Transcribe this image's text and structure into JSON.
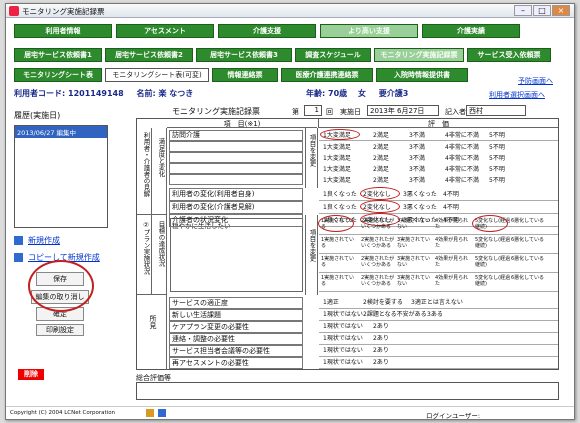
{
  "window": {
    "title": "モニタリング実施記録票"
  },
  "nav_row1": [
    "利用者情報",
    "アセスメント",
    "介護支援",
    "より高い支援",
    "介護実績"
  ],
  "nav_row2": [
    "居宅サービス依頼書1",
    "居宅サービス依頼書2",
    "居宅サービス依頼書3",
    "調査スケジュール",
    "モニタリング実施記録票",
    "サービス受入依頼票"
  ],
  "nav_row3": [
    "モニタリングシート表",
    "モニタリングシート表(可変)",
    "情報連絡票",
    "医療介護連携連絡票",
    "入院時情報提供書"
  ],
  "links": {
    "prev": "予防画面へ",
    "select": "利用者選択画面へ"
  },
  "user": {
    "code_label": "利用者コード:",
    "code": "1201149148",
    "name_label": "名前:",
    "name": "楽 なつき",
    "age_label": "年齢:",
    "age": "70歳",
    "sex": "女",
    "care_label": "要介護3"
  },
  "history": {
    "title": "履歴(実施日)",
    "item": "2013/06/27 編集中"
  },
  "left_links": {
    "new": "新規作成",
    "copy": "コピーして新規作成"
  },
  "buttons": {
    "save": "保存",
    "cancel": "編集の取り消し",
    "confirm": "確定",
    "print": "印刷設定",
    "delete": "削除"
  },
  "form": {
    "title": "モニタリング実施記録票",
    "no_label": "第",
    "no": "1",
    "no_suffix": "回",
    "date_label": "実施日",
    "date": "2013年 6月27日",
    "recorder_label": "記入者",
    "recorder": "西村",
    "col_item": "項　目(※1)",
    "col_eval": "評　価"
  },
  "section1": {
    "label": "利用者・介護者の見解",
    "sub": "満足度と変化",
    "vert": "項目を変更"
  },
  "sat_row": {
    "item": "訪問介護",
    "opts": [
      "1大変満足",
      "2満足",
      "3不満",
      "4非常に不満",
      "5不明"
    ]
  },
  "sat_empty_opts": [
    "1大変満足",
    "2満足",
    "3不満",
    "4非常に不満",
    "5不明"
  ],
  "change_rows": [
    {
      "item": "利用者の変化(利用者自身)",
      "opts": [
        "1良くなった",
        "2変化なし",
        "3悪くなった",
        "4不明"
      ]
    },
    {
      "item": "利用者の変化(介護者見解)",
      "opts": [
        "1良くなった",
        "2変化なし",
        "3悪くなった",
        "4不明"
      ]
    },
    {
      "item": "介護者の状況変化",
      "opts": [
        "1良くなった",
        "2変化なし",
        "3悪くなった",
        "4不明"
      ]
    }
  ],
  "section2": {
    "label": "②プラン実施状況",
    "sub": "目標の達成状況",
    "vert": "項目を変更",
    "item": "穏やかに生活したい"
  },
  "goal_opts": [
    "1実施されている",
    "2実施されたがいくつかある",
    "3実施されていない",
    "4効果が見られた",
    "5変化なし(経過継続)",
    "6悪化している"
  ],
  "section3": {
    "label": "所見"
  },
  "find_rows": [
    {
      "item": "サービスの適正度",
      "opts": [
        "1適正",
        "2検討を要する",
        "3適正とは言えない"
      ]
    },
    {
      "item": "新しい生活課題",
      "opts": [
        "1現状ではない",
        "2課題となる不安がある",
        "3ある"
      ]
    },
    {
      "item": "ケアプラン変更の必要性",
      "opts": [
        "1現状ではない",
        "2あり"
      ]
    },
    {
      "item": "連絡・調整の必要性",
      "opts": [
        "1現状ではない",
        "2あり"
      ]
    },
    {
      "item": "サービス担当者会議等の必要性",
      "opts": [
        "1現状ではない",
        "2あり"
      ]
    },
    {
      "item": "再アセスメントの必要性",
      "opts": [
        "1現状ではない",
        "2あり"
      ]
    }
  ],
  "summary_label": "総合評価等",
  "footer": {
    "copyright": "Copyright (C) 2004 LCNet Corporation",
    "login": "ログインユーザー:"
  },
  "colors": {
    "green": "#2d8a2d",
    "lightgreen": "#9acf9a",
    "red": "#c02020",
    "titleblue": "#1a2a8a"
  }
}
